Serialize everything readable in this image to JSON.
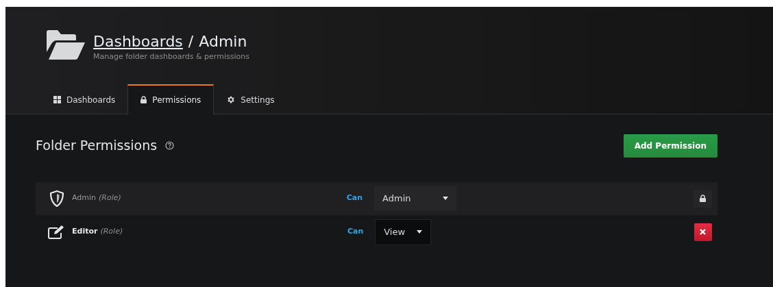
{
  "header": {
    "breadcrumb_link": "Dashboards",
    "separator": "/",
    "title": "Admin",
    "subtitle": "Manage folder dashboards & permissions"
  },
  "tabs": [
    {
      "label": "Dashboards",
      "kind": "grid",
      "selected": false
    },
    {
      "label": "Permissions",
      "kind": "lock",
      "selected": true
    },
    {
      "label": "Settings",
      "kind": "gear",
      "selected": false
    }
  ],
  "section": {
    "title": "Folder Permissions",
    "add_button": "Add Permission"
  },
  "permissions": [
    {
      "kind": "locked",
      "name": "Admin",
      "suffix": "(Role)",
      "disabled": true,
      "verb": "Can",
      "permission": "Admin"
    },
    {
      "kind": "removable",
      "name": "Editor",
      "suffix": "(Role)",
      "disabled": false,
      "verb": "Can",
      "permission": "View"
    }
  ]
}
